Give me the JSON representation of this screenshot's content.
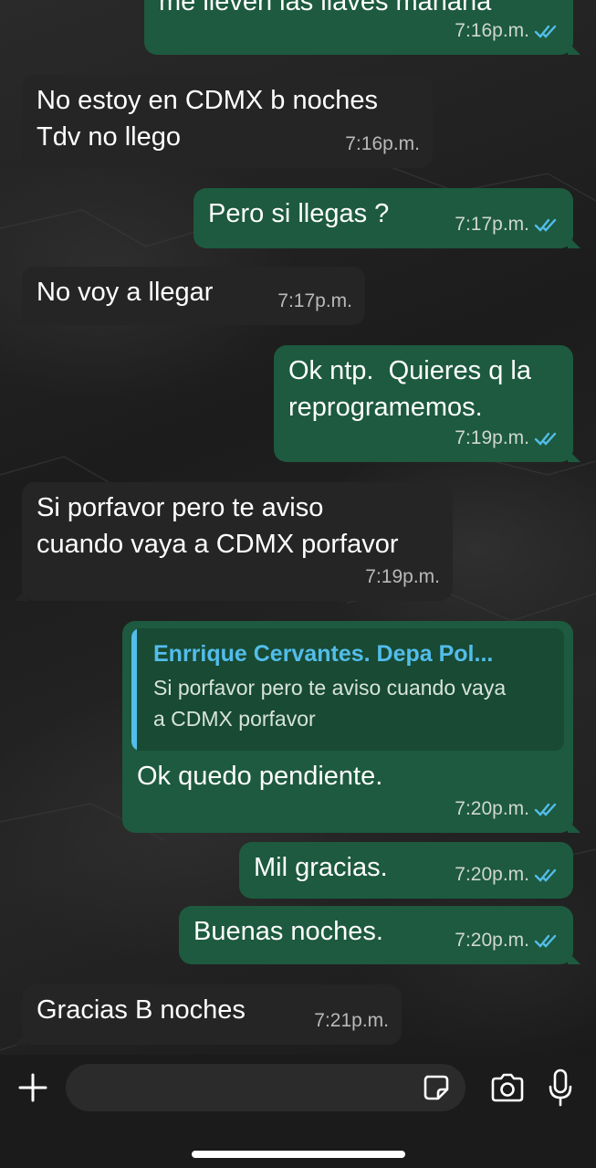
{
  "messages": [
    {
      "direction": "out",
      "text": "me lleven las llaves mañana",
      "time": "7:16p.m.",
      "status": "read"
    },
    {
      "direction": "in",
      "text": "No estoy en CDMX b noches\nTdv no llego",
      "time": "7:16p.m."
    },
    {
      "direction": "out",
      "text": "Pero si llegas ?",
      "time": "7:17p.m.",
      "status": "read"
    },
    {
      "direction": "in",
      "text": "No voy a llegar",
      "time": "7:17p.m."
    },
    {
      "direction": "out",
      "text": "Ok ntp.  Quieres q la\nreprogramemos.",
      "time": "7:19p.m.",
      "status": "read"
    },
    {
      "direction": "in",
      "text": "Si porfavor pero te aviso\ncuando vaya a CDMX porfavor",
      "time": "7:19p.m."
    },
    {
      "direction": "out",
      "text": "Ok quedo pendiente.",
      "time": "7:20p.m.",
      "status": "read",
      "quote": {
        "author": "Enrrique Cervantes. Depa Pol...",
        "text": "Si porfavor pero te aviso cuando vaya\na CDMX porfavor"
      }
    },
    {
      "direction": "out",
      "text": "Mil gracias.",
      "time": "7:20p.m.",
      "status": "read"
    },
    {
      "direction": "out",
      "text": "Buenas noches.",
      "time": "7:20p.m.",
      "status": "read"
    },
    {
      "direction": "in",
      "text": "Gracias B noches",
      "time": "7:21p.m."
    }
  ],
  "composer": {
    "placeholder": "",
    "add_icon": "plus-icon",
    "sticker_icon": "sticker-icon",
    "camera_icon": "camera-icon",
    "mic_icon": "microphone-icon"
  },
  "colors": {
    "outgoing_bubble": "#1d5a3f",
    "incoming_bubble": "#252525",
    "quote_accent": "#53bdeb",
    "read_ticks": "#53bdeb"
  }
}
